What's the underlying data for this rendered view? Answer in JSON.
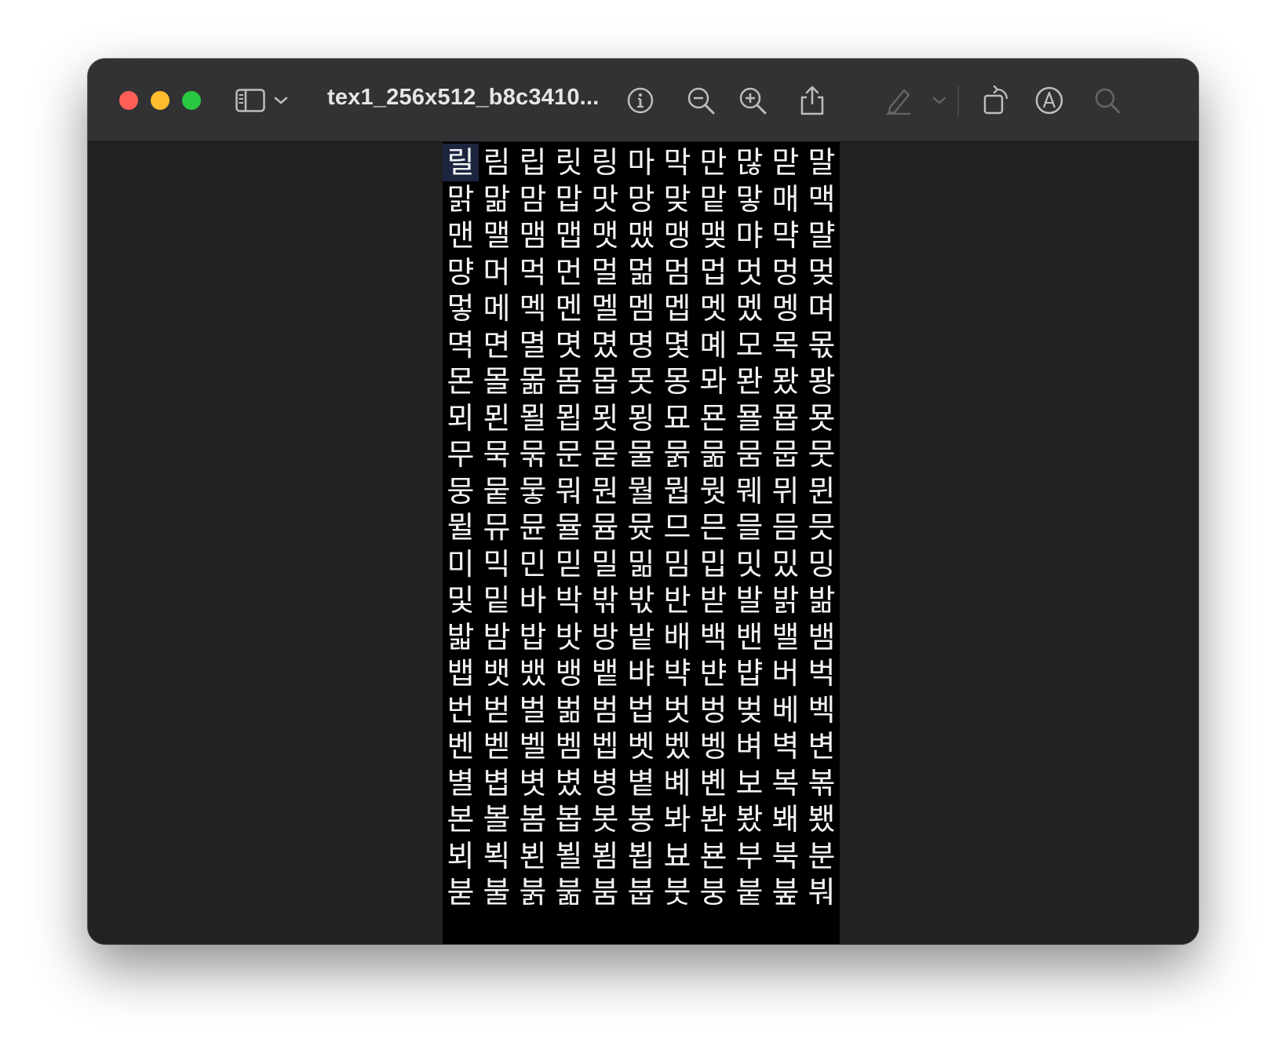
{
  "window": {
    "title": "tex1_256x512_b8c3410..."
  },
  "toolbar": {
    "icons": [
      "sidebar-toggle-icon",
      "chevron-down-icon",
      "info-icon",
      "zoom-out-icon",
      "zoom-in-icon",
      "share-icon",
      "markup-pen-icon",
      "chevron-down-icon",
      "rotate-icon",
      "annotate-icon",
      "search-icon"
    ],
    "colors": {
      "close": "#ff5f57",
      "minimize": "#febc2e",
      "maximize": "#28c840"
    }
  },
  "glyph_rows": [
    [
      "릴",
      "림",
      "립",
      "릿",
      "링",
      "마",
      "막",
      "만",
      "많",
      "맏",
      "말"
    ],
    [
      "맑",
      "맒",
      "맘",
      "맙",
      "맛",
      "망",
      "맞",
      "맡",
      "맣",
      "매",
      "맥"
    ],
    [
      "맨",
      "맬",
      "맴",
      "맵",
      "맷",
      "맸",
      "맹",
      "맺",
      "먀",
      "먁",
      "먈"
    ],
    [
      "먕",
      "머",
      "먹",
      "먼",
      "멀",
      "멂",
      "멈",
      "멉",
      "멋",
      "멍",
      "멎"
    ],
    [
      "멓",
      "메",
      "멕",
      "멘",
      "멜",
      "멤",
      "멥",
      "멧",
      "멨",
      "멩",
      "며"
    ],
    [
      "멱",
      "면",
      "멸",
      "몃",
      "몄",
      "명",
      "몇",
      "몌",
      "모",
      "목",
      "몫"
    ],
    [
      "몬",
      "몰",
      "몲",
      "몸",
      "몹",
      "못",
      "몽",
      "뫄",
      "뫈",
      "뫘",
      "뫙"
    ],
    [
      "뫼",
      "묀",
      "묄",
      "묍",
      "묏",
      "묑",
      "묘",
      "묜",
      "묠",
      "묩",
      "묫"
    ],
    [
      "무",
      "묵",
      "묶",
      "문",
      "묻",
      "물",
      "묽",
      "묾",
      "뭄",
      "뭅",
      "뭇"
    ],
    [
      "뭉",
      "뭍",
      "뭏",
      "뭐",
      "뭔",
      "뭘",
      "뭡",
      "뭣",
      "뭬",
      "뮈",
      "뮌"
    ],
    [
      "뮐",
      "뮤",
      "뮨",
      "뮬",
      "뮴",
      "뮷",
      "므",
      "믄",
      "믈",
      "믐",
      "믓"
    ],
    [
      "미",
      "믹",
      "민",
      "믿",
      "밀",
      "밂",
      "밈",
      "밉",
      "밋",
      "밌",
      "밍"
    ],
    [
      "및",
      "밑",
      "바",
      "박",
      "밖",
      "밗",
      "반",
      "받",
      "발",
      "밝",
      "밞"
    ],
    [
      "밟",
      "밤",
      "밥",
      "밧",
      "방",
      "밭",
      "배",
      "백",
      "밴",
      "밸",
      "뱀"
    ],
    [
      "뱁",
      "뱃",
      "뱄",
      "뱅",
      "뱉",
      "뱌",
      "뱍",
      "뱐",
      "뱝",
      "버",
      "벅"
    ],
    [
      "번",
      "벋",
      "벌",
      "벎",
      "범",
      "법",
      "벗",
      "벙",
      "벚",
      "베",
      "벡"
    ],
    [
      "벤",
      "벧",
      "벨",
      "벰",
      "벱",
      "벳",
      "벴",
      "벵",
      "벼",
      "벽",
      "변"
    ],
    [
      "별",
      "볍",
      "볏",
      "볐",
      "병",
      "볕",
      "볘",
      "볜",
      "보",
      "복",
      "볶"
    ],
    [
      "본",
      "볼",
      "봄",
      "봅",
      "봇",
      "봉",
      "봐",
      "봔",
      "봤",
      "봬",
      "뵀"
    ],
    [
      "뵈",
      "뵉",
      "뵌",
      "뵐",
      "뵘",
      "뵙",
      "뵤",
      "뵨",
      "부",
      "북",
      "분"
    ],
    [
      "붇",
      "불",
      "붉",
      "붊",
      "붐",
      "붑",
      "붓",
      "붕",
      "붙",
      "붚",
      "붜"
    ]
  ]
}
